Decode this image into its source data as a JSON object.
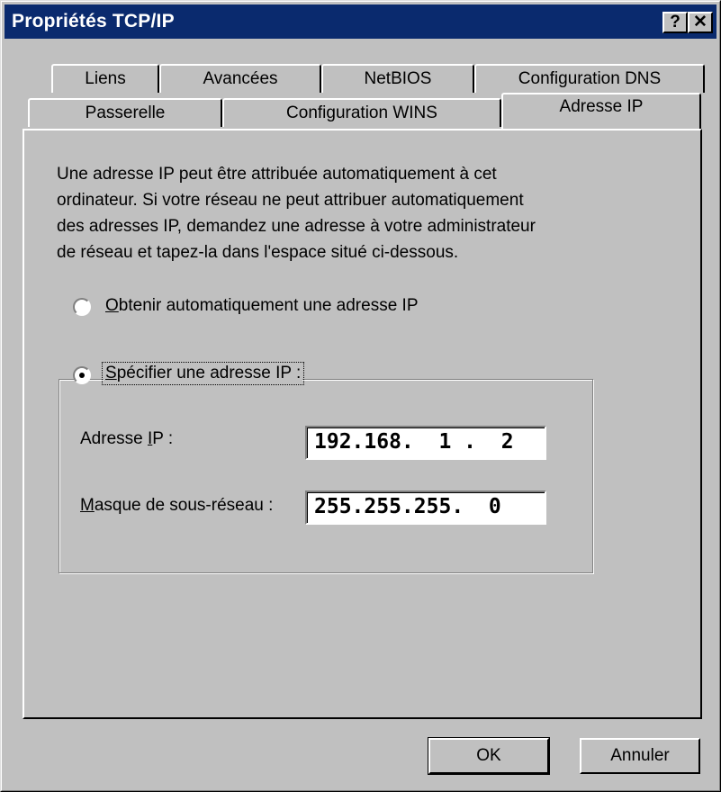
{
  "window": {
    "title": "Propriétés TCP/IP",
    "help_label": "?",
    "close_label": "✕"
  },
  "tabs_row1": [
    {
      "label": "Liens"
    },
    {
      "label": "Avancées"
    },
    {
      "label": "NetBIOS"
    },
    {
      "label": "Configuration DNS"
    }
  ],
  "tabs_row2": [
    {
      "label": "Passerelle"
    },
    {
      "label": "Configuration WINS"
    },
    {
      "label": "Adresse IP",
      "active": true
    }
  ],
  "panel": {
    "description": "Une adresse IP peut être attribuée automatiquement à cet\nordinateur. Si votre réseau ne peut attribuer automatiquement\ndes adresses IP, demandez une adresse à votre administrateur\nde réseau et tapez-la dans l'espace situé ci-dessous.",
    "option_auto": {
      "mnemonic": "O",
      "rest": "btenir automatiquement une adresse IP",
      "selected": false
    },
    "option_specify": {
      "mnemonic": "S",
      "rest": "pécifier une adresse IP :",
      "selected": true
    },
    "ip_label": {
      "before": "Adresse ",
      "mnemonic": "I",
      "after": "P :"
    },
    "ip_value": "192.168.  1 .  2",
    "mask_label": {
      "mnemonic": "M",
      "after": "asque de sous-réseau :"
    },
    "mask_value": "255.255.255.  0"
  },
  "buttons": {
    "ok": "OK",
    "cancel": "Annuler"
  }
}
